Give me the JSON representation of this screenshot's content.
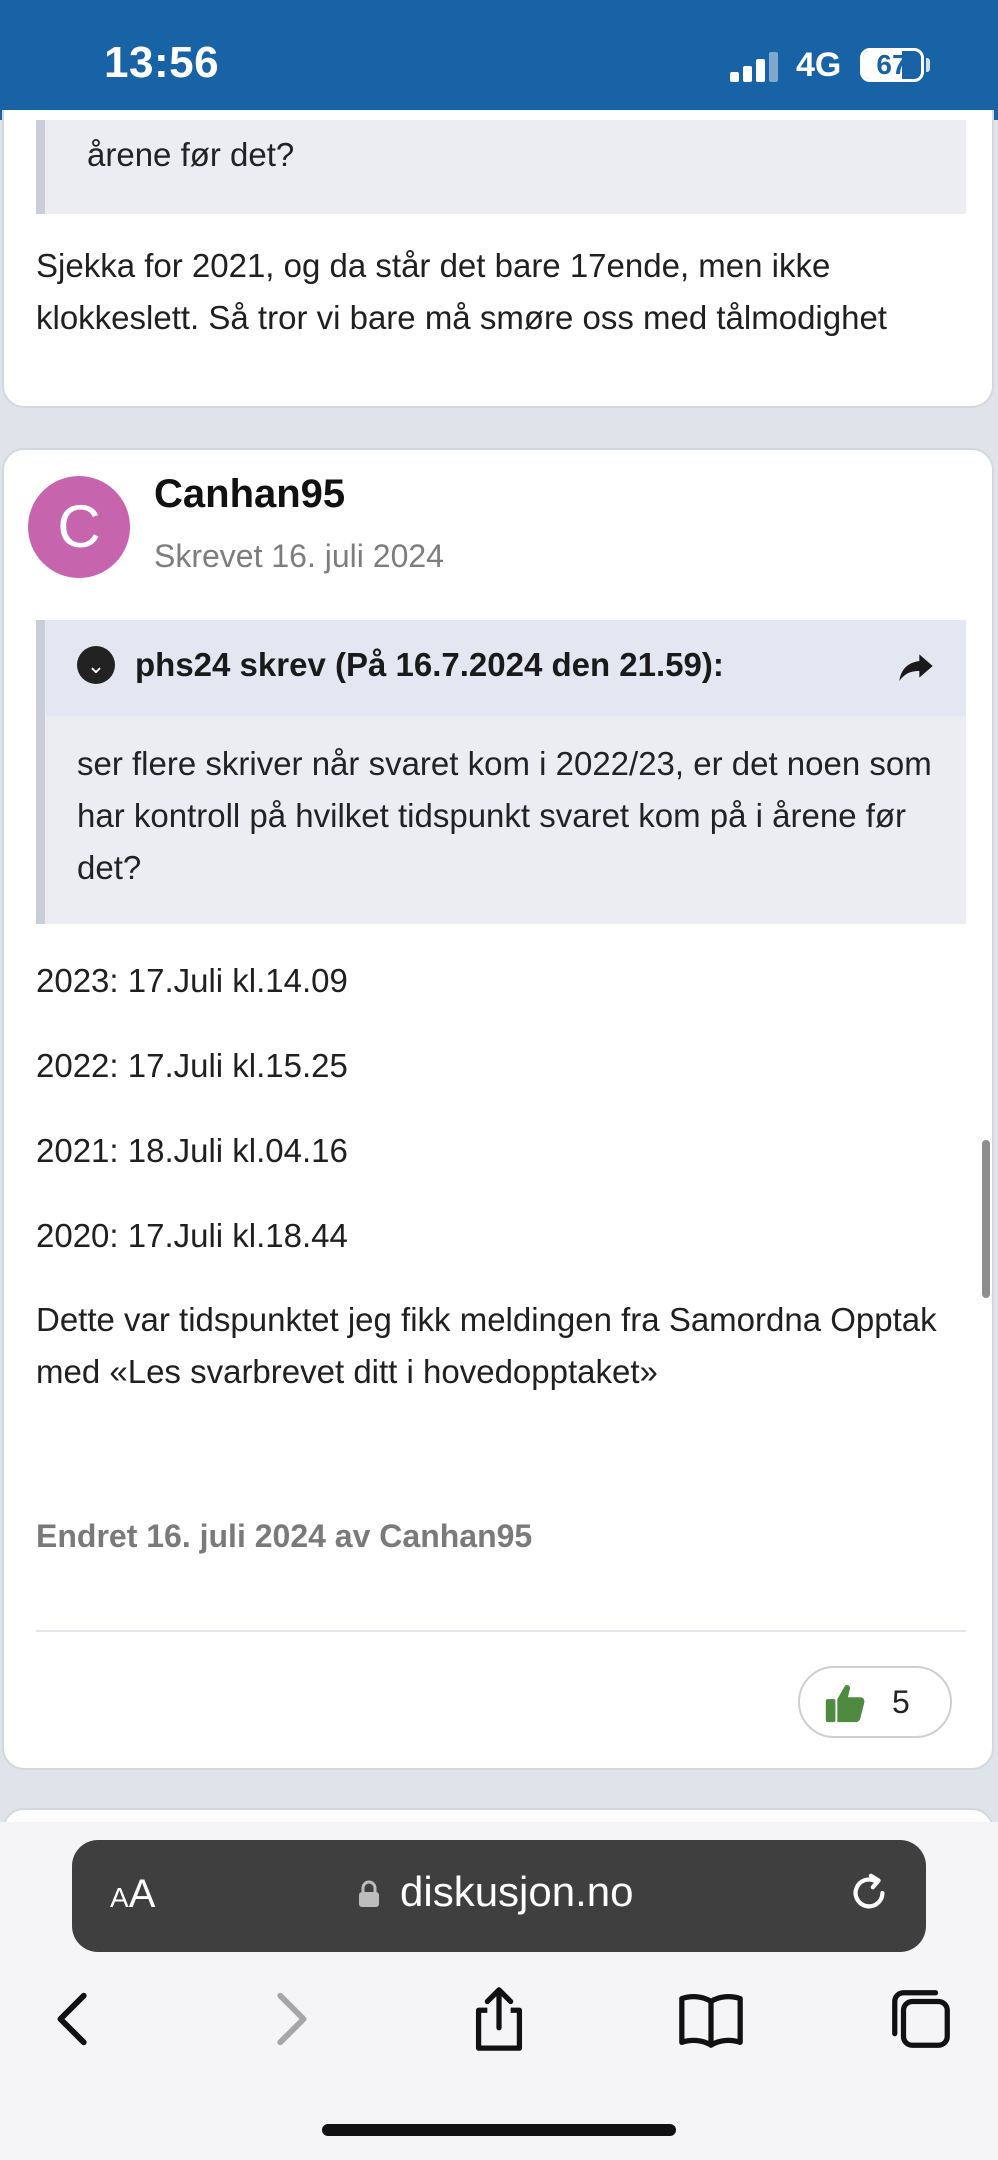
{
  "status_bar": {
    "time": "13:56",
    "network": "4G",
    "battery": "67",
    "battery_level": 0.67
  },
  "previous_post": {
    "quote_tail": "årene før det?",
    "text": "Sjekka for 2021, og da står det bare 17ende, men ikke klokkeslett. Så tror vi bare må smøre oss med tålmodighet"
  },
  "post": {
    "avatar_letter": "C",
    "avatar_color": "#c764ae",
    "author": "Canhan95",
    "date": "Skrevet 16. juli 2024",
    "quote": {
      "title": "phs24 skrev (På 16.7.2024 den 21.59):",
      "body": "ser flere skriver når svaret kom i 2022/23, er det noen som har kontroll på hvilket tidspunkt svaret kom på i årene før det?"
    },
    "lines": [
      "2023: 17.Juli kl.14.09",
      "2022: 17.Juli kl.15.25",
      "2021: 18.Juli kl.04.16",
      "2020: 17.Juli kl.18.44"
    ],
    "closing": "Dette var tidspunktet jeg fikk meldingen fra Samordna Opptak med «Les svarbrevet ditt i hovedopptaket»",
    "edited": "Endret 16. juli 2024 av Canhan95",
    "reaction": {
      "icon": "thumbs-up-icon",
      "count": "5",
      "color": "#4e8a3f"
    }
  },
  "browser": {
    "text_size_small": "A",
    "text_size_large": "A",
    "url": "diskusjon.no",
    "toolbar_icons": [
      "back-icon",
      "forward-icon",
      "share-icon",
      "bookmarks-icon",
      "tabs-icon"
    ]
  },
  "colors": {
    "status_bar": "#1862a6",
    "page_bg": "#dfe3ea"
  }
}
